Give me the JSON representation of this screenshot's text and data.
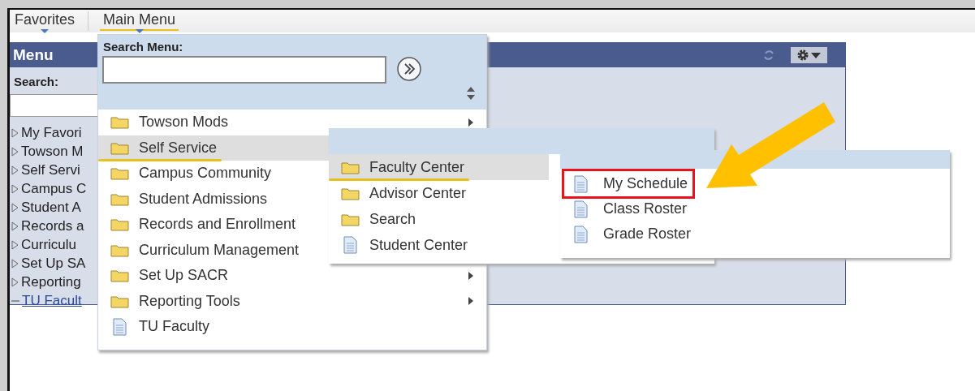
{
  "top_nav": [
    {
      "label": "Favorites",
      "selected": false
    },
    {
      "label": "Main Menu",
      "selected": true
    }
  ],
  "menu_panel": {
    "title": "Menu",
    "search_label": "Search:",
    "items": [
      {
        "label": "My Favori",
        "kind": "folder"
      },
      {
        "label": "Towson M",
        "kind": "folder"
      },
      {
        "label": "Self Servi",
        "kind": "folder"
      },
      {
        "label": "Campus C",
        "kind": "folder"
      },
      {
        "label": "Student A",
        "kind": "folder"
      },
      {
        "label": "Records a",
        "kind": "folder"
      },
      {
        "label": "Curriculu",
        "kind": "folder"
      },
      {
        "label": "Set Up SA",
        "kind": "folder"
      },
      {
        "label": "Reporting",
        "kind": "folder"
      },
      {
        "label": "TU Facult",
        "kind": "link"
      }
    ]
  },
  "main_menu": {
    "search_label": "Search Menu:",
    "items": [
      {
        "label": "Towson Mods",
        "kind": "folder",
        "has_submenu": true,
        "selected": false
      },
      {
        "label": "Self Service",
        "kind": "folder",
        "has_submenu": false,
        "selected": true
      },
      {
        "label": "Campus Community",
        "kind": "folder",
        "has_submenu": false,
        "selected": false
      },
      {
        "label": "Student Admissions",
        "kind": "folder",
        "has_submenu": false,
        "selected": false
      },
      {
        "label": "Records and Enrollment",
        "kind": "folder",
        "has_submenu": false,
        "selected": false
      },
      {
        "label": "Curriculum Management",
        "kind": "folder",
        "has_submenu": false,
        "selected": false
      },
      {
        "label": "Set Up SACR",
        "kind": "folder",
        "has_submenu": true,
        "selected": false
      },
      {
        "label": "Reporting Tools",
        "kind": "folder",
        "has_submenu": true,
        "selected": false
      },
      {
        "label": "TU Faculty",
        "kind": "document",
        "has_submenu": false,
        "selected": false
      }
    ]
  },
  "self_service_menu": {
    "items": [
      {
        "label": "Faculty Center",
        "kind": "folder",
        "selected": true
      },
      {
        "label": "Advisor Center",
        "kind": "folder",
        "selected": false
      },
      {
        "label": "Search",
        "kind": "folder",
        "selected": false
      },
      {
        "label": "Student Center",
        "kind": "document",
        "selected": false
      }
    ]
  },
  "faculty_center_menu": {
    "items": [
      {
        "label": "My Schedule",
        "kind": "document",
        "highlighted": true
      },
      {
        "label": "Class Roster",
        "kind": "document",
        "highlighted": false
      },
      {
        "label": "Grade Roster",
        "kind": "document",
        "highlighted": false
      }
    ]
  }
}
